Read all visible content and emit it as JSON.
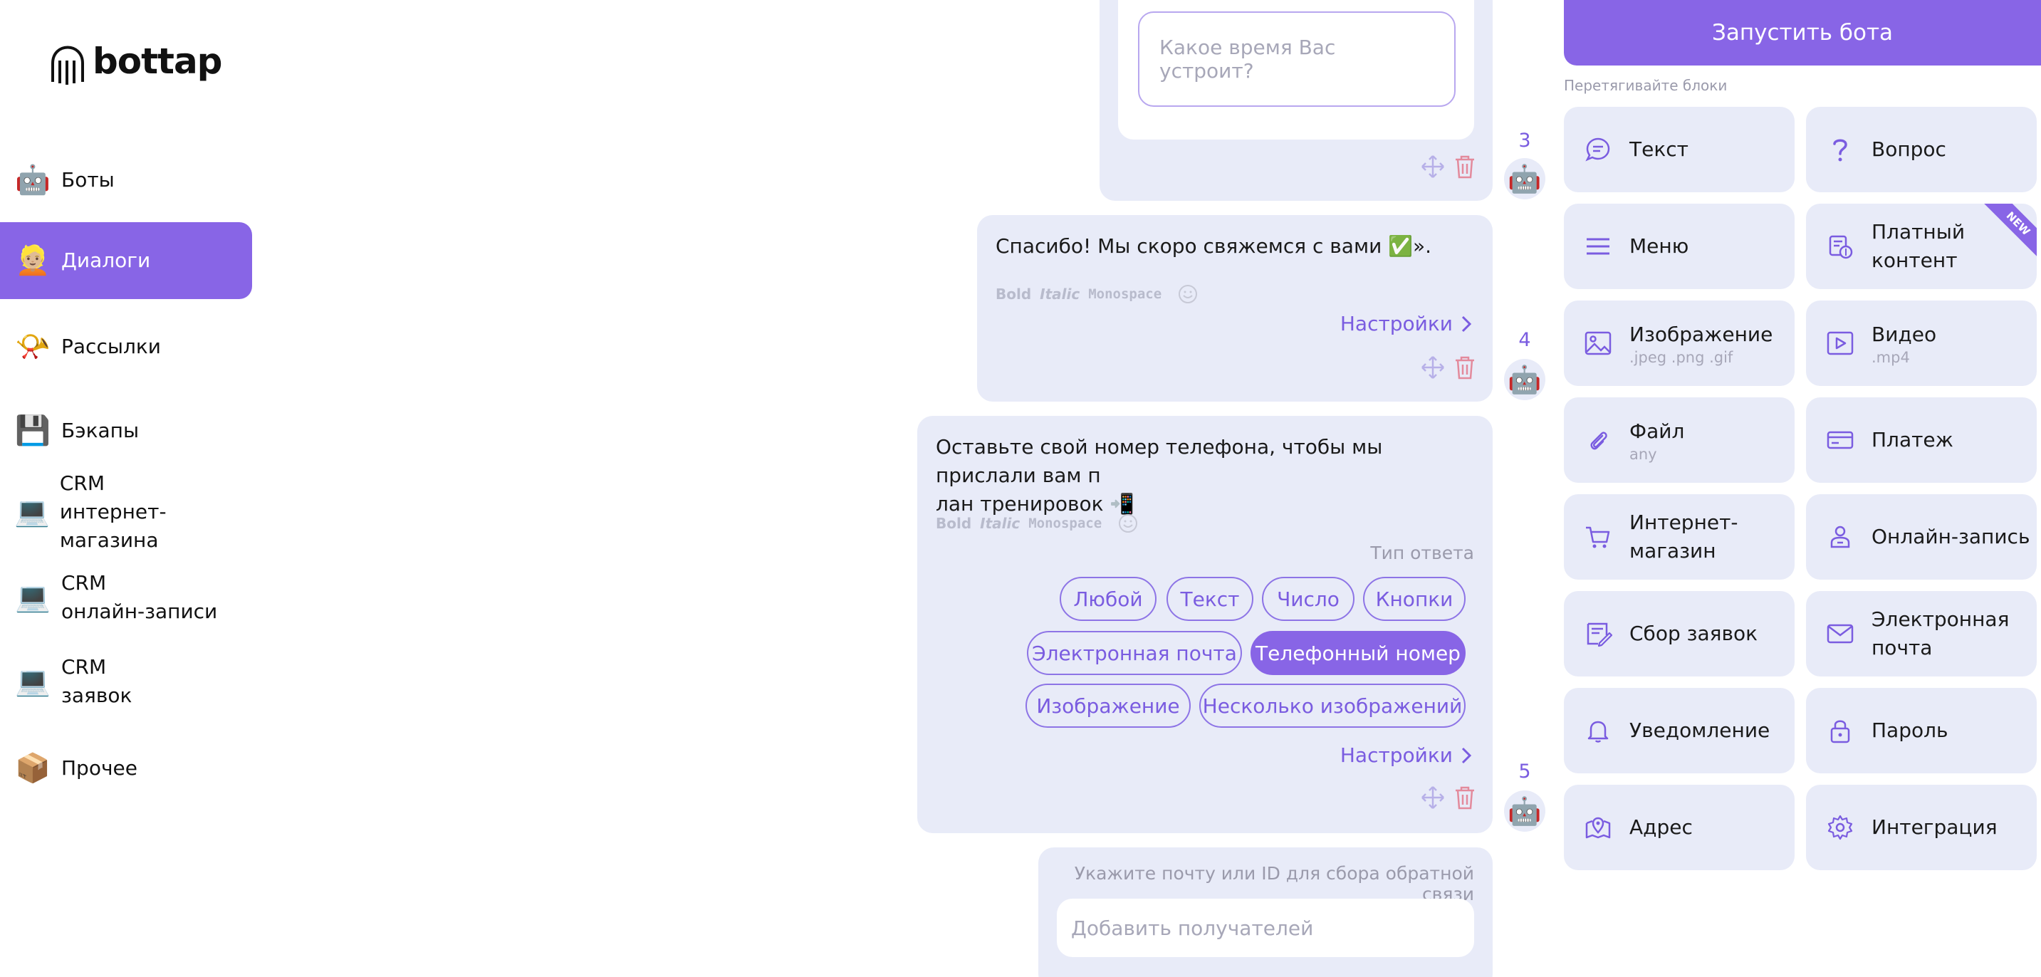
{
  "brand": {
    "name": "bottap"
  },
  "sidebar": {
    "items": [
      {
        "emoji": "🤖",
        "label": "Боты",
        "active": false
      },
      {
        "emoji": "👱🏼",
        "label": "Диалоги",
        "active": true
      },
      {
        "emoji": "📯",
        "label": "Рассылки",
        "active": false
      },
      {
        "emoji": "💾",
        "label": "Бэкапы",
        "active": false
      },
      {
        "emoji": "💻",
        "label": "CRM\nинтернет-магазина",
        "active": false
      },
      {
        "emoji": "💻",
        "label": "CRM\nонлайн-записи",
        "active": false
      },
      {
        "emoji": "💻",
        "label": "CRM\nзаявок",
        "active": false
      },
      {
        "emoji": "📦",
        "label": "Прочее",
        "active": false
      }
    ]
  },
  "chat": {
    "card1": {
      "placeholder": "Какое время Вас устроит?",
      "step": "3"
    },
    "card2": {
      "text": "Спасибо! Мы скоро свяжемся с вами ✅».",
      "settings": "Настройки",
      "step": "4"
    },
    "card3": {
      "text": "Оставьте свой номер телефона, чтобы мы прислали вам п\nлан тренировок 📲",
      "answer_type_label": "Тип ответа",
      "chips": [
        "Любой",
        "Текст",
        "Число",
        "Кнопки",
        "Электронная почта",
        "Телефонный номер",
        "Изображение",
        "Несколько изображений"
      ],
      "active_chip": "Телефонный номер",
      "settings": "Настройки",
      "step": "5"
    },
    "card4": {
      "hint": "Укажите почту или ID для сбора обратной связи",
      "recipients_placeholder": "Добавить получателей"
    },
    "format": {
      "bold": "Bold",
      "italic": "Italic",
      "mono": "Monospace"
    },
    "robot_emoji": "🤖"
  },
  "panel": {
    "launch_label": "Запустить бота",
    "drag_label": "Перетягивайте блоки",
    "new_badge": "NEW",
    "blocks": [
      {
        "icon": "chat-icon",
        "label": "Текст",
        "sub": ""
      },
      {
        "icon": "question-icon",
        "label": "Вопрос",
        "sub": ""
      },
      {
        "icon": "menu-icon",
        "label": "Меню",
        "sub": ""
      },
      {
        "icon": "paid-content-icon",
        "label": "Платный контент",
        "sub": "",
        "badge": true
      },
      {
        "icon": "image-icon",
        "label": "Изображение",
        "sub": ".jpeg .png .gif"
      },
      {
        "icon": "video-icon",
        "label": "Видео",
        "sub": ".mp4"
      },
      {
        "icon": "paperclip-icon",
        "label": "Файл",
        "sub": "any"
      },
      {
        "icon": "card-icon",
        "label": "Платеж",
        "sub": ""
      },
      {
        "icon": "cart-icon",
        "label": "Интернет-магазин",
        "sub": ""
      },
      {
        "icon": "person-badge-icon",
        "label": "Онлайн-запись",
        "sub": ""
      },
      {
        "icon": "form-icon",
        "label": "Сбор заявок",
        "sub": ""
      },
      {
        "icon": "mail-icon",
        "label": "Электронная почта",
        "sub": ""
      },
      {
        "icon": "bell-icon",
        "label": "Уведомление",
        "sub": ""
      },
      {
        "icon": "lock-icon",
        "label": "Пароль",
        "sub": ""
      },
      {
        "icon": "map-pin-icon",
        "label": "Адрес",
        "sub": ""
      },
      {
        "icon": "gear-icon",
        "label": "Интеграция",
        "sub": ""
      }
    ]
  },
  "colors": {
    "accent": "#8865e6",
    "card": "#e8ebf8",
    "danger": "#e38a9c"
  }
}
